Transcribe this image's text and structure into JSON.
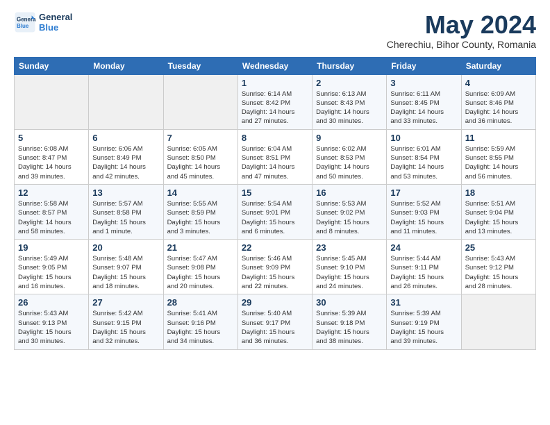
{
  "logo": {
    "line1": "General",
    "line2": "Blue"
  },
  "title": "May 2024",
  "subtitle": "Cherechiu, Bihor County, Romania",
  "days_header": [
    "Sunday",
    "Monday",
    "Tuesday",
    "Wednesday",
    "Thursday",
    "Friday",
    "Saturday"
  ],
  "weeks": [
    [
      {
        "day": "",
        "info": ""
      },
      {
        "day": "",
        "info": ""
      },
      {
        "day": "",
        "info": ""
      },
      {
        "day": "1",
        "info": "Sunrise: 6:14 AM\nSunset: 8:42 PM\nDaylight: 14 hours\nand 27 minutes."
      },
      {
        "day": "2",
        "info": "Sunrise: 6:13 AM\nSunset: 8:43 PM\nDaylight: 14 hours\nand 30 minutes."
      },
      {
        "day": "3",
        "info": "Sunrise: 6:11 AM\nSunset: 8:45 PM\nDaylight: 14 hours\nand 33 minutes."
      },
      {
        "day": "4",
        "info": "Sunrise: 6:09 AM\nSunset: 8:46 PM\nDaylight: 14 hours\nand 36 minutes."
      }
    ],
    [
      {
        "day": "5",
        "info": "Sunrise: 6:08 AM\nSunset: 8:47 PM\nDaylight: 14 hours\nand 39 minutes."
      },
      {
        "day": "6",
        "info": "Sunrise: 6:06 AM\nSunset: 8:49 PM\nDaylight: 14 hours\nand 42 minutes."
      },
      {
        "day": "7",
        "info": "Sunrise: 6:05 AM\nSunset: 8:50 PM\nDaylight: 14 hours\nand 45 minutes."
      },
      {
        "day": "8",
        "info": "Sunrise: 6:04 AM\nSunset: 8:51 PM\nDaylight: 14 hours\nand 47 minutes."
      },
      {
        "day": "9",
        "info": "Sunrise: 6:02 AM\nSunset: 8:53 PM\nDaylight: 14 hours\nand 50 minutes."
      },
      {
        "day": "10",
        "info": "Sunrise: 6:01 AM\nSunset: 8:54 PM\nDaylight: 14 hours\nand 53 minutes."
      },
      {
        "day": "11",
        "info": "Sunrise: 5:59 AM\nSunset: 8:55 PM\nDaylight: 14 hours\nand 56 minutes."
      }
    ],
    [
      {
        "day": "12",
        "info": "Sunrise: 5:58 AM\nSunset: 8:57 PM\nDaylight: 14 hours\nand 58 minutes."
      },
      {
        "day": "13",
        "info": "Sunrise: 5:57 AM\nSunset: 8:58 PM\nDaylight: 15 hours\nand 1 minute."
      },
      {
        "day": "14",
        "info": "Sunrise: 5:55 AM\nSunset: 8:59 PM\nDaylight: 15 hours\nand 3 minutes."
      },
      {
        "day": "15",
        "info": "Sunrise: 5:54 AM\nSunset: 9:01 PM\nDaylight: 15 hours\nand 6 minutes."
      },
      {
        "day": "16",
        "info": "Sunrise: 5:53 AM\nSunset: 9:02 PM\nDaylight: 15 hours\nand 8 minutes."
      },
      {
        "day": "17",
        "info": "Sunrise: 5:52 AM\nSunset: 9:03 PM\nDaylight: 15 hours\nand 11 minutes."
      },
      {
        "day": "18",
        "info": "Sunrise: 5:51 AM\nSunset: 9:04 PM\nDaylight: 15 hours\nand 13 minutes."
      }
    ],
    [
      {
        "day": "19",
        "info": "Sunrise: 5:49 AM\nSunset: 9:05 PM\nDaylight: 15 hours\nand 16 minutes."
      },
      {
        "day": "20",
        "info": "Sunrise: 5:48 AM\nSunset: 9:07 PM\nDaylight: 15 hours\nand 18 minutes."
      },
      {
        "day": "21",
        "info": "Sunrise: 5:47 AM\nSunset: 9:08 PM\nDaylight: 15 hours\nand 20 minutes."
      },
      {
        "day": "22",
        "info": "Sunrise: 5:46 AM\nSunset: 9:09 PM\nDaylight: 15 hours\nand 22 minutes."
      },
      {
        "day": "23",
        "info": "Sunrise: 5:45 AM\nSunset: 9:10 PM\nDaylight: 15 hours\nand 24 minutes."
      },
      {
        "day": "24",
        "info": "Sunrise: 5:44 AM\nSunset: 9:11 PM\nDaylight: 15 hours\nand 26 minutes."
      },
      {
        "day": "25",
        "info": "Sunrise: 5:43 AM\nSunset: 9:12 PM\nDaylight: 15 hours\nand 28 minutes."
      }
    ],
    [
      {
        "day": "26",
        "info": "Sunrise: 5:43 AM\nSunset: 9:13 PM\nDaylight: 15 hours\nand 30 minutes."
      },
      {
        "day": "27",
        "info": "Sunrise: 5:42 AM\nSunset: 9:15 PM\nDaylight: 15 hours\nand 32 minutes."
      },
      {
        "day": "28",
        "info": "Sunrise: 5:41 AM\nSunset: 9:16 PM\nDaylight: 15 hours\nand 34 minutes."
      },
      {
        "day": "29",
        "info": "Sunrise: 5:40 AM\nSunset: 9:17 PM\nDaylight: 15 hours\nand 36 minutes."
      },
      {
        "day": "30",
        "info": "Sunrise: 5:39 AM\nSunset: 9:18 PM\nDaylight: 15 hours\nand 38 minutes."
      },
      {
        "day": "31",
        "info": "Sunrise: 5:39 AM\nSunset: 9:19 PM\nDaylight: 15 hours\nand 39 minutes."
      },
      {
        "day": "",
        "info": ""
      }
    ]
  ]
}
